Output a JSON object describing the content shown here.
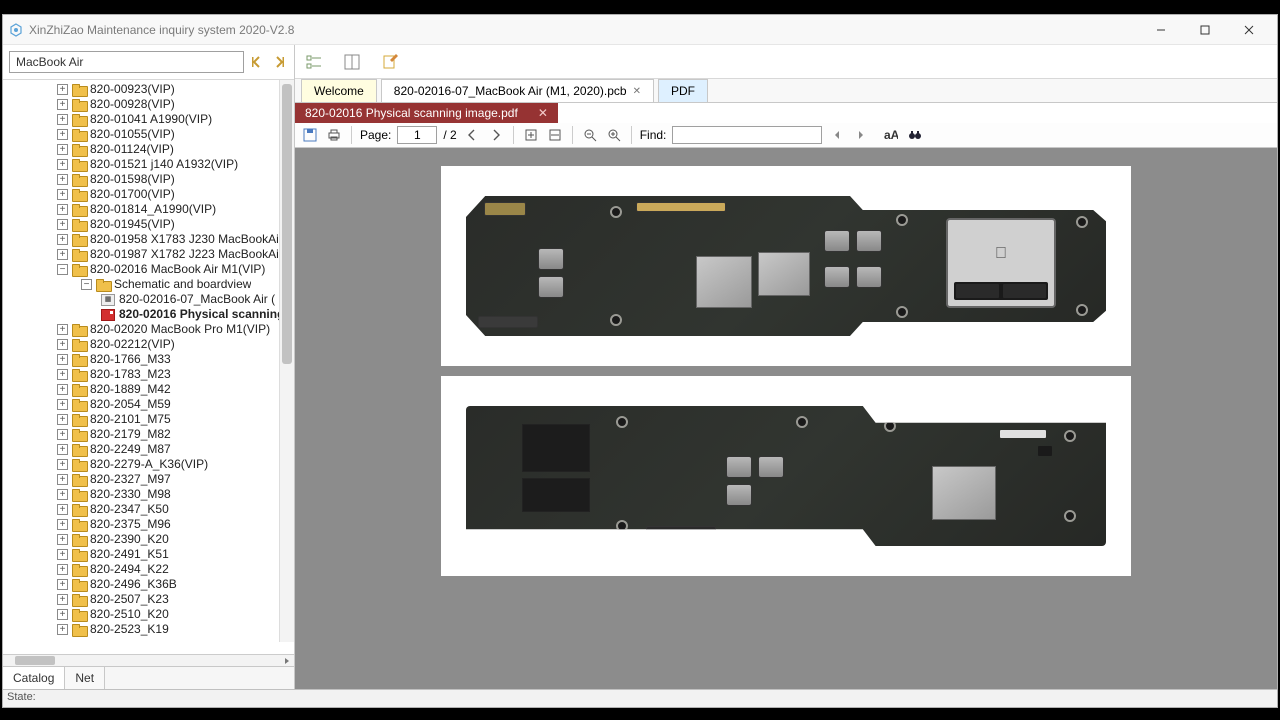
{
  "window": {
    "title": "XinZhiZao Maintenance inquiry system 2020-V2.8"
  },
  "sidebar": {
    "search_value": "MacBook Air",
    "tabs": {
      "catalog": "Catalog",
      "net": "Net"
    },
    "items": [
      {
        "indent": 52,
        "type": "folder",
        "label": "820-00923(VIP)"
      },
      {
        "indent": 52,
        "type": "folder",
        "label": "820-00928(VIP)"
      },
      {
        "indent": 52,
        "type": "folder",
        "label": "820-01041 A1990(VIP)"
      },
      {
        "indent": 52,
        "type": "folder",
        "label": "820-01055(VIP)"
      },
      {
        "indent": 52,
        "type": "folder",
        "label": "820-01124(VIP)"
      },
      {
        "indent": 52,
        "type": "folder",
        "label": "820-01521 j140 A1932(VIP)"
      },
      {
        "indent": 52,
        "type": "folder",
        "label": "820-01598(VIP)"
      },
      {
        "indent": 52,
        "type": "folder",
        "label": "820-01700(VIP)"
      },
      {
        "indent": 52,
        "type": "folder",
        "label": "820-01814_A1990(VIP)"
      },
      {
        "indent": 52,
        "type": "folder",
        "label": "820-01945(VIP)"
      },
      {
        "indent": 52,
        "type": "folder",
        "label": "820-01958 X1783 J230 MacBookAir"
      },
      {
        "indent": 52,
        "type": "folder",
        "label": "820-01987 X1782 J223 MacBookAir"
      },
      {
        "indent": 52,
        "type": "folder",
        "label": "820-02016 MacBook Air M1(VIP)",
        "expanded": true
      },
      {
        "indent": 76,
        "type": "folder",
        "label": "Schematic and boardview",
        "expanded": true
      },
      {
        "indent": 96,
        "type": "pcb",
        "label": "820-02016-07_MacBook Air ("
      },
      {
        "indent": 96,
        "type": "pdf",
        "label": "820-02016 Physical scanning",
        "active": true
      },
      {
        "indent": 52,
        "type": "folder",
        "label": "820-02020 MacBook Pro M1(VIP)"
      },
      {
        "indent": 52,
        "type": "folder",
        "label": "820-02212(VIP)"
      },
      {
        "indent": 52,
        "type": "folder",
        "label": "820-1766_M33"
      },
      {
        "indent": 52,
        "type": "folder",
        "label": "820-1783_M23"
      },
      {
        "indent": 52,
        "type": "folder",
        "label": "820-1889_M42"
      },
      {
        "indent": 52,
        "type": "folder",
        "label": "820-2054_M59"
      },
      {
        "indent": 52,
        "type": "folder",
        "label": "820-2101_M75"
      },
      {
        "indent": 52,
        "type": "folder",
        "label": "820-2179_M82"
      },
      {
        "indent": 52,
        "type": "folder",
        "label": "820-2249_M87"
      },
      {
        "indent": 52,
        "type": "folder",
        "label": "820-2279-A_K36(VIP)"
      },
      {
        "indent": 52,
        "type": "folder",
        "label": "820-2327_M97"
      },
      {
        "indent": 52,
        "type": "folder",
        "label": "820-2330_M98"
      },
      {
        "indent": 52,
        "type": "folder",
        "label": "820-2347_K50"
      },
      {
        "indent": 52,
        "type": "folder",
        "label": "820-2375_M96"
      },
      {
        "indent": 52,
        "type": "folder",
        "label": "820-2390_K20"
      },
      {
        "indent": 52,
        "type": "folder",
        "label": "820-2491_K51"
      },
      {
        "indent": 52,
        "type": "folder",
        "label": "820-2494_K22"
      },
      {
        "indent": 52,
        "type": "folder",
        "label": "820-2496_K36B"
      },
      {
        "indent": 52,
        "type": "folder",
        "label": "820-2507_K23"
      },
      {
        "indent": 52,
        "type": "folder",
        "label": "820-2510_K20"
      },
      {
        "indent": 52,
        "type": "folder",
        "label": "820-2523_K19"
      }
    ]
  },
  "tabs": {
    "welcome": "Welcome",
    "pcb": "820-02016-07_MacBook Air (M1, 2020).pcb",
    "pdf": "PDF"
  },
  "subtab": "820-02016 Physical scanning image.pdf",
  "findbar": {
    "page_label": "Page:",
    "page_value": "1",
    "page_total": "/ 2",
    "find_label": "Find:"
  },
  "statusbar": "State:"
}
